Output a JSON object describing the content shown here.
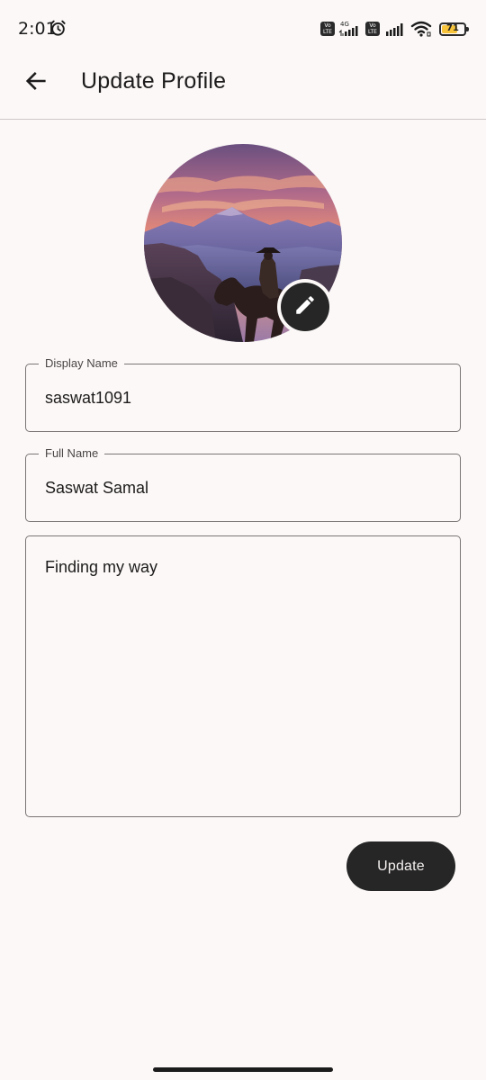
{
  "status_bar": {
    "time": "2:01",
    "network_type": "4G",
    "volte_label": "Vo LTE",
    "battery_level": "71",
    "battery_percent": 71,
    "icons": [
      "alarm-icon",
      "volte-icon",
      "signal-icon",
      "wifi-icon",
      "battery-icon"
    ]
  },
  "app_bar": {
    "title": "Update Profile",
    "back_icon": "arrow-back-icon"
  },
  "avatar": {
    "edit_icon": "pencil-icon"
  },
  "form": {
    "display_name": {
      "label": "Display Name",
      "value": "saswat1091"
    },
    "full_name": {
      "label": "Full Name",
      "value": "Saswat Samal"
    },
    "bio": {
      "value": "Finding my way"
    },
    "update_label": "Update"
  },
  "colors": {
    "background": "#fbf8f7",
    "primary_dark": "#262626",
    "outline": "#7a7574",
    "battery": "#f6c33b"
  }
}
